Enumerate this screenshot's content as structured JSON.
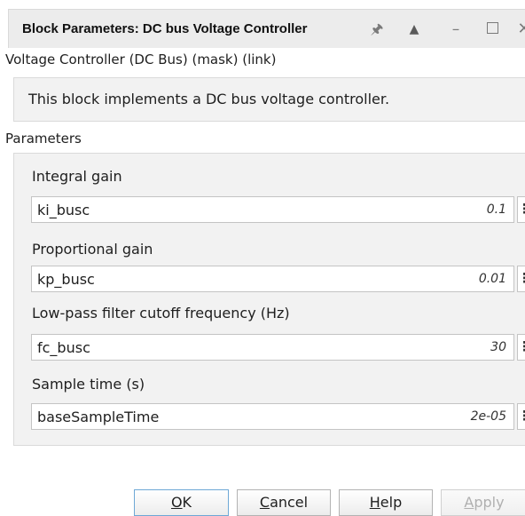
{
  "window": {
    "title": "Block Parameters: DC bus Voltage Controller",
    "icons": [
      "pin-icon",
      "up-arrow-icon",
      "minimize-icon",
      "maximize-icon",
      "close-icon"
    ],
    "minimize_glyph": "–",
    "close_glyph": "✕"
  },
  "mask_title": "Voltage Controller (DC Bus) (mask) (link)",
  "description": "This block implements a DC bus voltage controller.",
  "parameters_header": "Parameters",
  "parameters": [
    {
      "label": "Integral gain",
      "value": "ki_busc",
      "evaluated": "0.1"
    },
    {
      "label": "Proportional gain",
      "value": "kp_busc",
      "evaluated": "0.01"
    },
    {
      "label": "Low-pass filter cutoff frequency (Hz)",
      "value": "fc_busc",
      "evaluated": "30"
    },
    {
      "label": "Sample time (s)",
      "value": "baseSampleTime",
      "evaluated": "2e-05"
    }
  ],
  "buttons": {
    "ok": {
      "mnemonic": "O",
      "rest": "K"
    },
    "cancel": {
      "mnemonic": "C",
      "rest": "ancel"
    },
    "help": {
      "mnemonic": "H",
      "rest": "elp"
    },
    "apply": {
      "mnemonic": "A",
      "rest": "pply"
    }
  },
  "colors": {
    "accent_border": "#6ea8d6",
    "panel_bg": "#f2f2f2",
    "titlebar_bg": "#ececec"
  }
}
